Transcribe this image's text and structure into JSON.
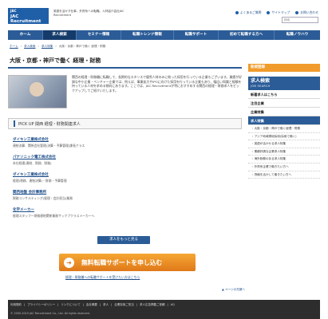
{
  "header": {
    "logo_text": "JAC Recruitment",
    "logo_mark": "JAC",
    "tagline": "英語を活かす仕事、外資系への転職。人材紹介会社JAC Recruitment",
    "top_links": [
      "よくあるご質問",
      "サイトマップ",
      "お問い合わせ"
    ],
    "search_placeholder": "検索"
  },
  "nav": {
    "items": [
      {
        "label": "ホーム",
        "active": false,
        "w": 0
      },
      {
        "label": "求人検索",
        "active": true,
        "w": 0
      },
      {
        "label": "セミナー情報",
        "active": false,
        "w": 0
      },
      {
        "label": "転職トレンド情報",
        "active": false,
        "w": 0
      },
      {
        "label": "転職サポート",
        "active": false,
        "w": 0
      },
      {
        "label": "初めて転職する方へ",
        "active": false,
        "w": 0
      },
      {
        "label": "転職ノウハウ",
        "active": false,
        "w": 0
      }
    ]
  },
  "breadcrumb": [
    "ホーム",
    "求人検索",
    "求人特集",
    "大阪・京都・神戸で働く 経理・財務"
  ],
  "main": {
    "title": "大阪・京都・神戸で働く 経理・財務",
    "intro": "関西の経理・財務職に転職して、長期的なスタンスで優秀人材のみに絞った採用を行っている企業もございます。業績が好調な中小企業・ベンチャー企業では、例えば、事業拡大やIPOに向けた採用を行っている企業もあり、幅広い知識と経験を持っている人材を求める傾向にあります。ここでは、JAC Recruitmentが特におすすめする関西の経理・財務求人をピックアップしてご紹介いたします。",
    "pickup_title": "PICK UP 関西 経理・財務関連求人",
    "jobs": [
      {
        "name": "ダイキン工業株式会社",
        "desc": "連結決算、関係会社管理(決算・予算管理)課長クラス"
      },
      {
        "name": "パナソニック電工株式会社",
        "desc": "本社経理(連結、税務、財務)"
      },
      {
        "name": "ダイキン工業株式会社",
        "desc": "経理(税務、連結決算)・財務・予算管理"
      },
      {
        "name": "関西地盤 会計事務所",
        "desc": "税務コンサルティング(経理・会計担当)業務"
      },
      {
        "name": "化学メーカー",
        "desc": "経理スタッフ〜財務連結関係業務サックブクラスメーカーへ"
      }
    ],
    "more_button": "求人をもっと見る",
    "apply_button": "無料転職サポートを申し込む",
    "apply_sub": "経理・財務職への転職サポートを受けたい方はこちら",
    "page_top": "▲ ページの先頭へ"
  },
  "sidebar": {
    "register": "新規登録",
    "head_title": "求人検索",
    "head_sub": "JOB SEARCH",
    "sections": [
      {
        "label": "新着求人はこちら",
        "selected": false
      },
      {
        "label": "注目企業",
        "selected": false
      },
      {
        "label": "企業特集",
        "selected": false
      },
      {
        "label": "求人特集",
        "selected": true
      }
    ],
    "sub_items": [
      "大阪・京都・神戸で働く経理・財務",
      "アジア地域現地採用(採用で働く)",
      "英語が活かせる求人特集",
      "業績好調な企業求人特集",
      "海外勤務のある求人特集",
      "外資系企業で働きたい方へ",
      "資格を活かして働きたい方へ"
    ]
  },
  "footer": {
    "links": [
      "利用規約",
      "プライバシーポリシー",
      "リンクについて",
      "会社概要",
      "求人",
      "企業採用ご担当",
      "求人広告掲載ご依頼",
      "AQ"
    ],
    "copyright": "© 2000-2010 JAC Recruitment Co., Ltd. All rights reserved."
  }
}
